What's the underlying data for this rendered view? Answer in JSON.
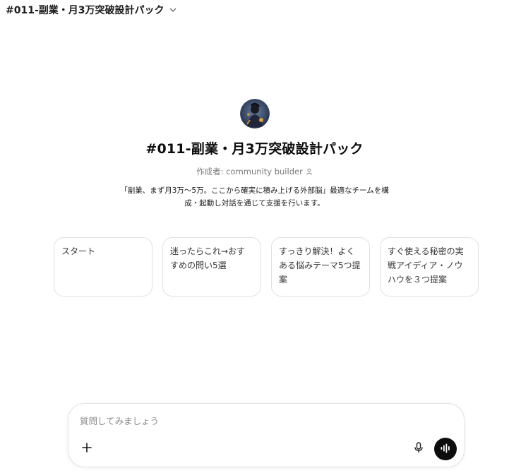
{
  "header": {
    "title": "#011-副業・月3万突破設計パック",
    "dropdown_icon": "chevron-down-icon"
  },
  "gpt": {
    "avatar_icon": "avatar-image",
    "name": "#011-副業・月3万突破設計パック",
    "creator": "作成者: community builder",
    "creator_icon": "person-icon",
    "description": "「副業、まず月3万〜5万。ここから確実に積み上げる外部脳」最適なチームを構成・起動し対話を通じて支援を行います。"
  },
  "starters": [
    {
      "label": "スタート"
    },
    {
      "label": "迷ったらこれ→おすすめの問い5選"
    },
    {
      "label": "すっきり解決！よくある悩みテーマ5つ提案"
    },
    {
      "label": "すぐ使える秘密の実戦アイディア・ノウハウを３つ提案"
    }
  ],
  "composer": {
    "placeholder": "質問してみましょう",
    "value": "",
    "add_icon": "plus-icon",
    "mic_icon": "microphone-icon",
    "voice_icon": "voice-mode-icon"
  },
  "colors": {
    "text": "#0d0d0d",
    "muted": "#7a7a7a",
    "border": "#e0e0e0",
    "voice_button": "#0d0d0d"
  }
}
